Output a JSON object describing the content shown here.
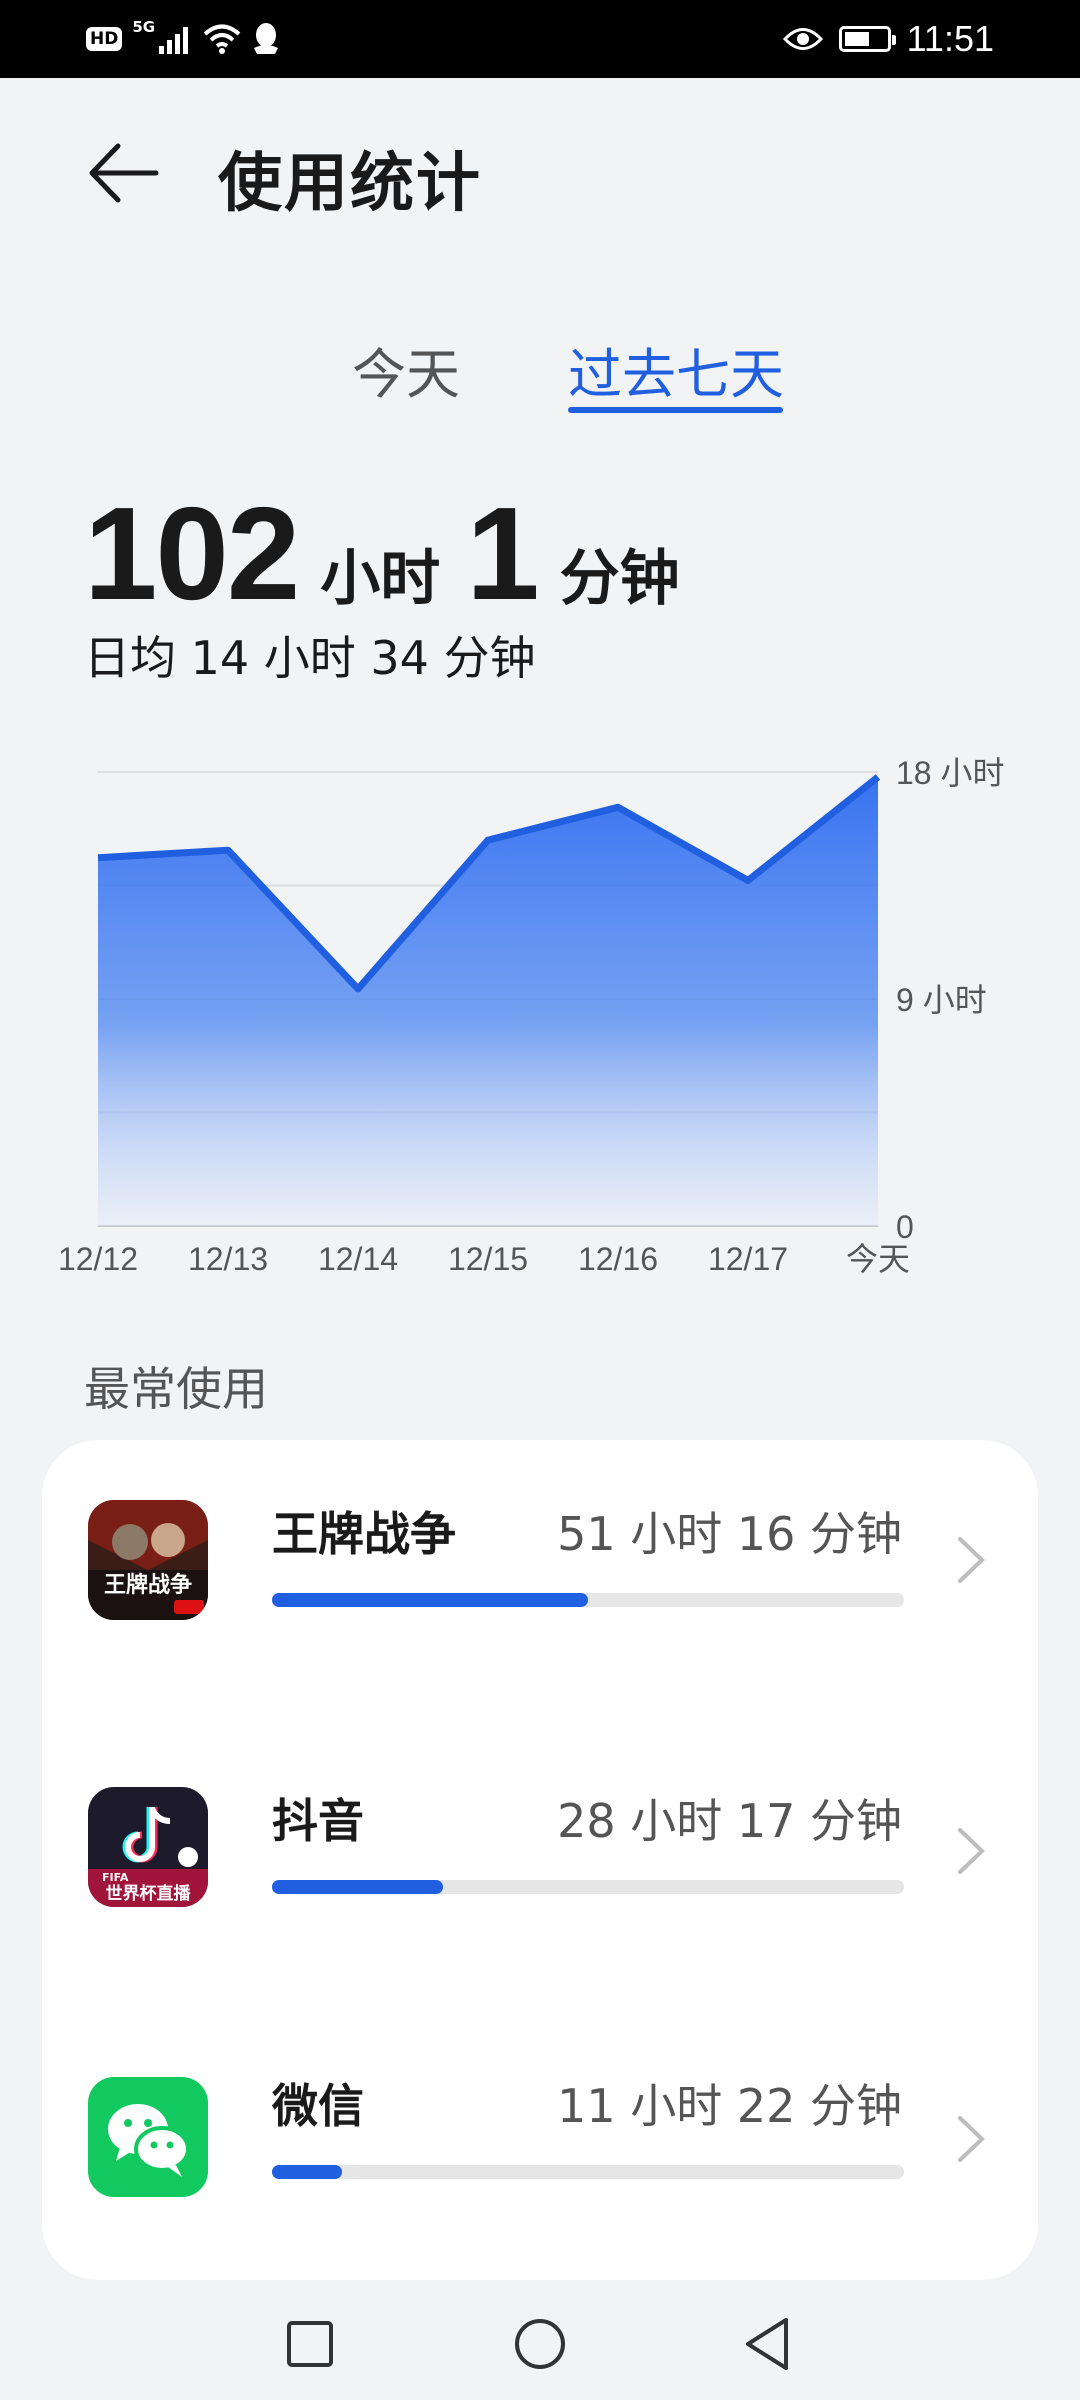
{
  "status_bar": {
    "hd": "HD",
    "network": "5G",
    "time": "11:51",
    "icons": [
      "signal-icon",
      "wifi-icon",
      "qq-icon",
      "eye-icon",
      "battery-icon"
    ],
    "battery_level": 0.62
  },
  "header": {
    "title": "使用统计"
  },
  "tabs": [
    {
      "label": "今天",
      "selected": false
    },
    {
      "label": "过去七天",
      "selected": true
    }
  ],
  "summary": {
    "hours": "102",
    "hours_unit": "小时",
    "minutes": "1",
    "minutes_unit": "分钟",
    "daily_avg": "日均 14 小时 34 分钟"
  },
  "chart_data": {
    "type": "area",
    "x": [
      "12/12",
      "12/13",
      "12/14",
      "12/15",
      "12/16",
      "12/17",
      "今天"
    ],
    "values": [
      14.6,
      14.9,
      9.4,
      15.3,
      16.6,
      13.7,
      17.8
    ],
    "ylim": [
      0,
      18
    ],
    "y_ticks": [
      {
        "value": 18,
        "label": "18 小时"
      },
      {
        "value": 9,
        "label": "9 小时"
      },
      {
        "value": 0,
        "label": "0"
      }
    ],
    "grid": true,
    "color": "#1f5fe0"
  },
  "section": {
    "label": "最常使用"
  },
  "apps": [
    {
      "name": "王牌战争",
      "time": "51 小时 16 分钟",
      "fraction": 0.5,
      "icon": "wangpai-app-icon"
    },
    {
      "name": "抖音",
      "time": "28 小时 17 分钟",
      "fraction": 0.27,
      "icon": "douyin-app-icon"
    },
    {
      "name": "微信",
      "time": "11 小时 22 分钟",
      "fraction": 0.11,
      "icon": "wechat-app-icon"
    }
  ],
  "icon_text": {
    "wangpai": "王牌战争",
    "douyin_fifa": "FIFA",
    "douyin_sub": "世界杯直播"
  }
}
